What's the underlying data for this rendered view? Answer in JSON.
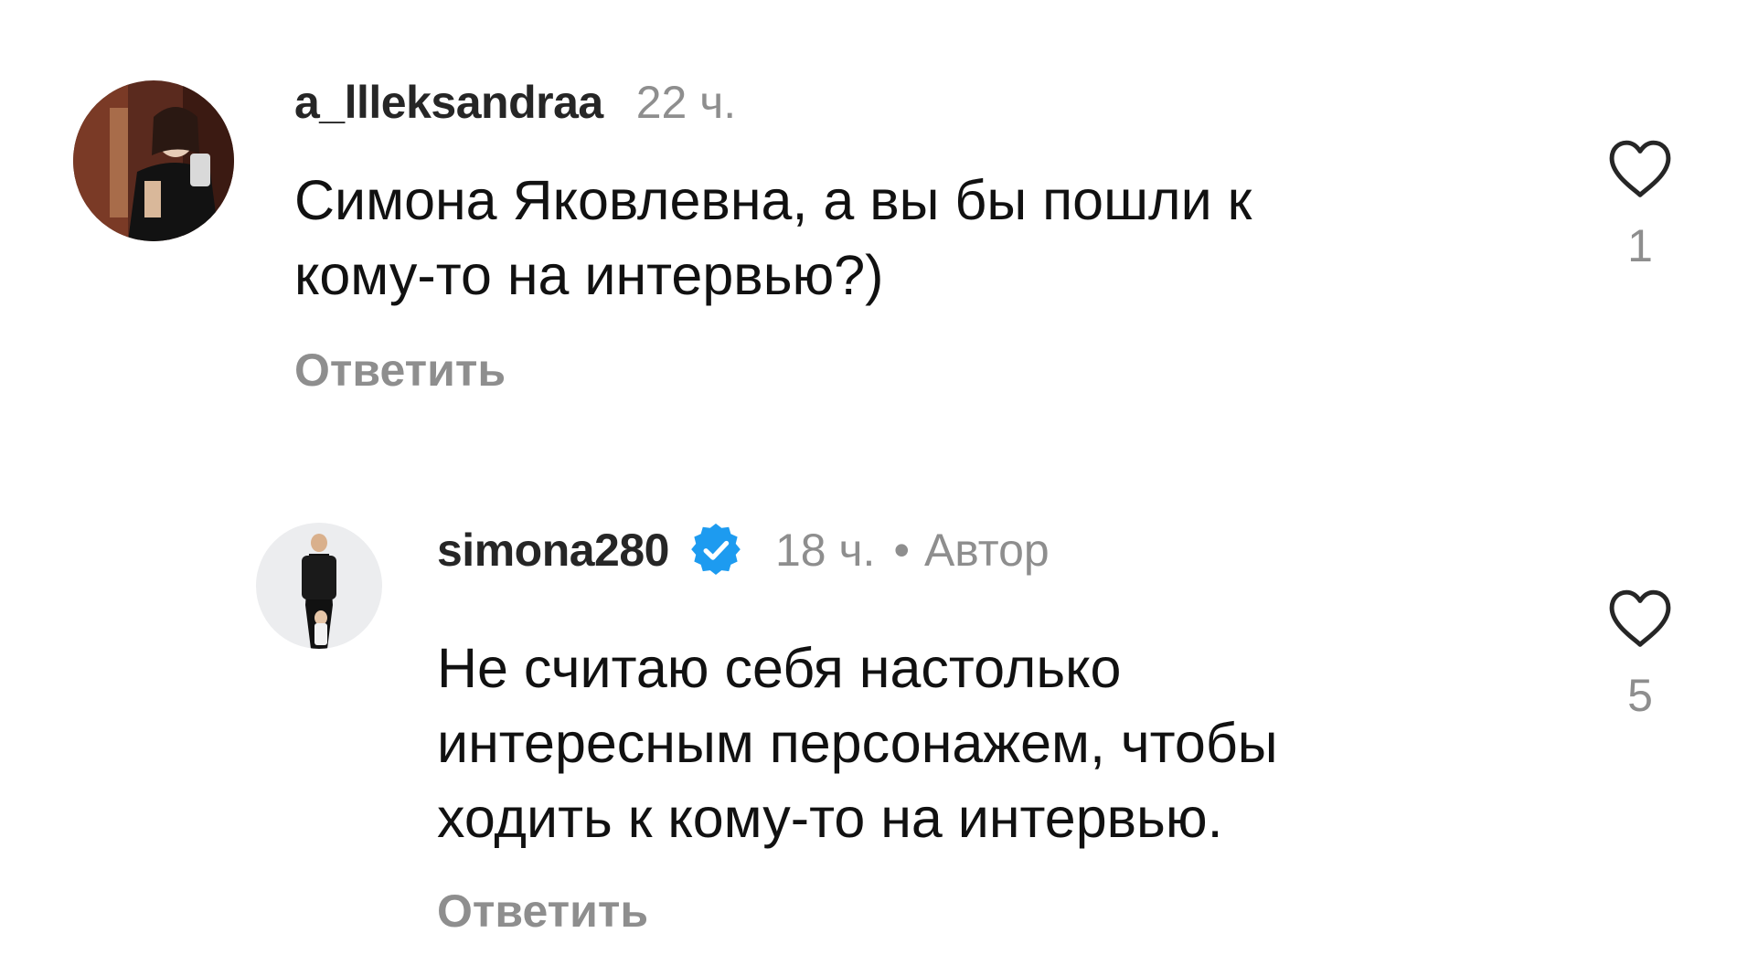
{
  "comments": [
    {
      "username": "a_llleksandraa",
      "time": "22 ч.",
      "text": "Симона Яковлевна, а вы бы пошли к\nкому-то на интервью?)",
      "reply_label": "Ответить",
      "likes": "1",
      "verified": false,
      "author": false
    },
    {
      "username": "simona280",
      "time": "18 ч.",
      "dot": "•",
      "author_label": "Автор",
      "text": "Не считаю себя настолько\nинтересным персонажем, чтобы\nходить к кому-то на интервью.",
      "reply_label": "Ответить",
      "likes": "5",
      "verified": true,
      "author": true
    }
  ],
  "icons": {
    "like": "heart-outline-icon",
    "verified": "verified-badge-icon"
  },
  "colors": {
    "verified_blue": "#1d9bf0",
    "secondary_text": "#8e8e8e",
    "primary_text": "#111111"
  }
}
